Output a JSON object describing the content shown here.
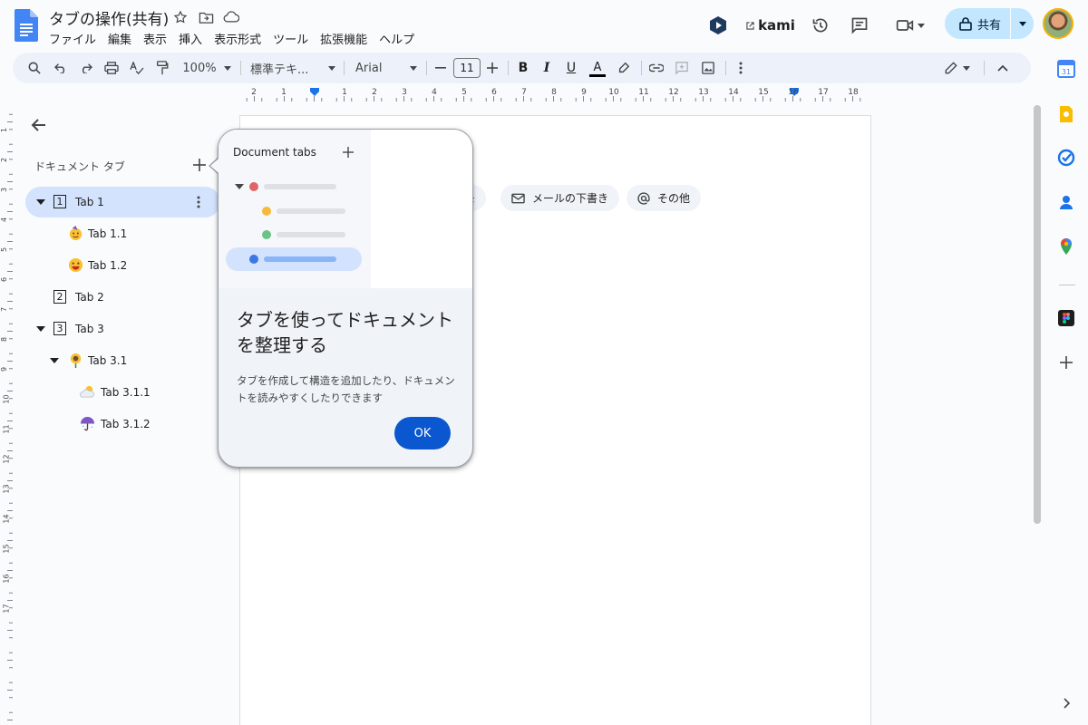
{
  "document": {
    "title": "タブの操作(共有)"
  },
  "menu": [
    "ファイル",
    "編集",
    "表示",
    "挿入",
    "表示形式",
    "ツール",
    "拡張機能",
    "ヘルプ"
  ],
  "header": {
    "kami_label": "kami",
    "share_label": "共有"
  },
  "toolbar": {
    "zoom": "100%",
    "style": "標準テキ...",
    "font": "Arial",
    "font_size": "11",
    "bold": "B",
    "italic": "I",
    "underline": "U",
    "text_color_letter": "A"
  },
  "ruler": {
    "numbers": [
      "2",
      "1",
      "1",
      "2",
      "3",
      "4",
      "5",
      "6",
      "7",
      "8",
      "9",
      "10",
      "11",
      "12",
      "13",
      "14",
      "15",
      "16",
      "17",
      "18"
    ]
  },
  "vruler": {
    "numbers": [
      "1",
      "2",
      "3",
      "4",
      "5",
      "6",
      "7",
      "8",
      "9",
      "10",
      "11",
      "12",
      "13",
      "14",
      "15",
      "16",
      "17"
    ]
  },
  "sidebar": {
    "heading": "ドキュメント タブ",
    "tabs": [
      {
        "label": "Tab 1",
        "num": "1",
        "active": true
      },
      {
        "label": "Tab 1.1"
      },
      {
        "label": "Tab 1.2"
      },
      {
        "label": "Tab 2",
        "num": "2"
      },
      {
        "label": "Tab 3",
        "num": "3"
      },
      {
        "label": "Tab 3.1"
      },
      {
        "label": "Tab 3.1.1"
      },
      {
        "label": "Tab 3.1.2"
      }
    ]
  },
  "chips": [
    {
      "label": "モ"
    },
    {
      "label": "メールの下書き"
    },
    {
      "label": "その他"
    }
  ],
  "popover": {
    "illustration_title": "Document tabs",
    "title": "タブを使ってドキュメントを整理する",
    "body": "タブを作成して構造を追加したり、ドキュメントを読みやすくしたりできます",
    "ok_label": "OK"
  },
  "colors": {
    "accent": "#0b57d0",
    "active_tab_bg": "#d3e3fd",
    "share_bg": "#c2e7ff",
    "dot_red": "#e06666",
    "dot_yellow": "#f6b93b",
    "dot_green": "#6cc287",
    "dot_blue": "#3b78e7"
  }
}
